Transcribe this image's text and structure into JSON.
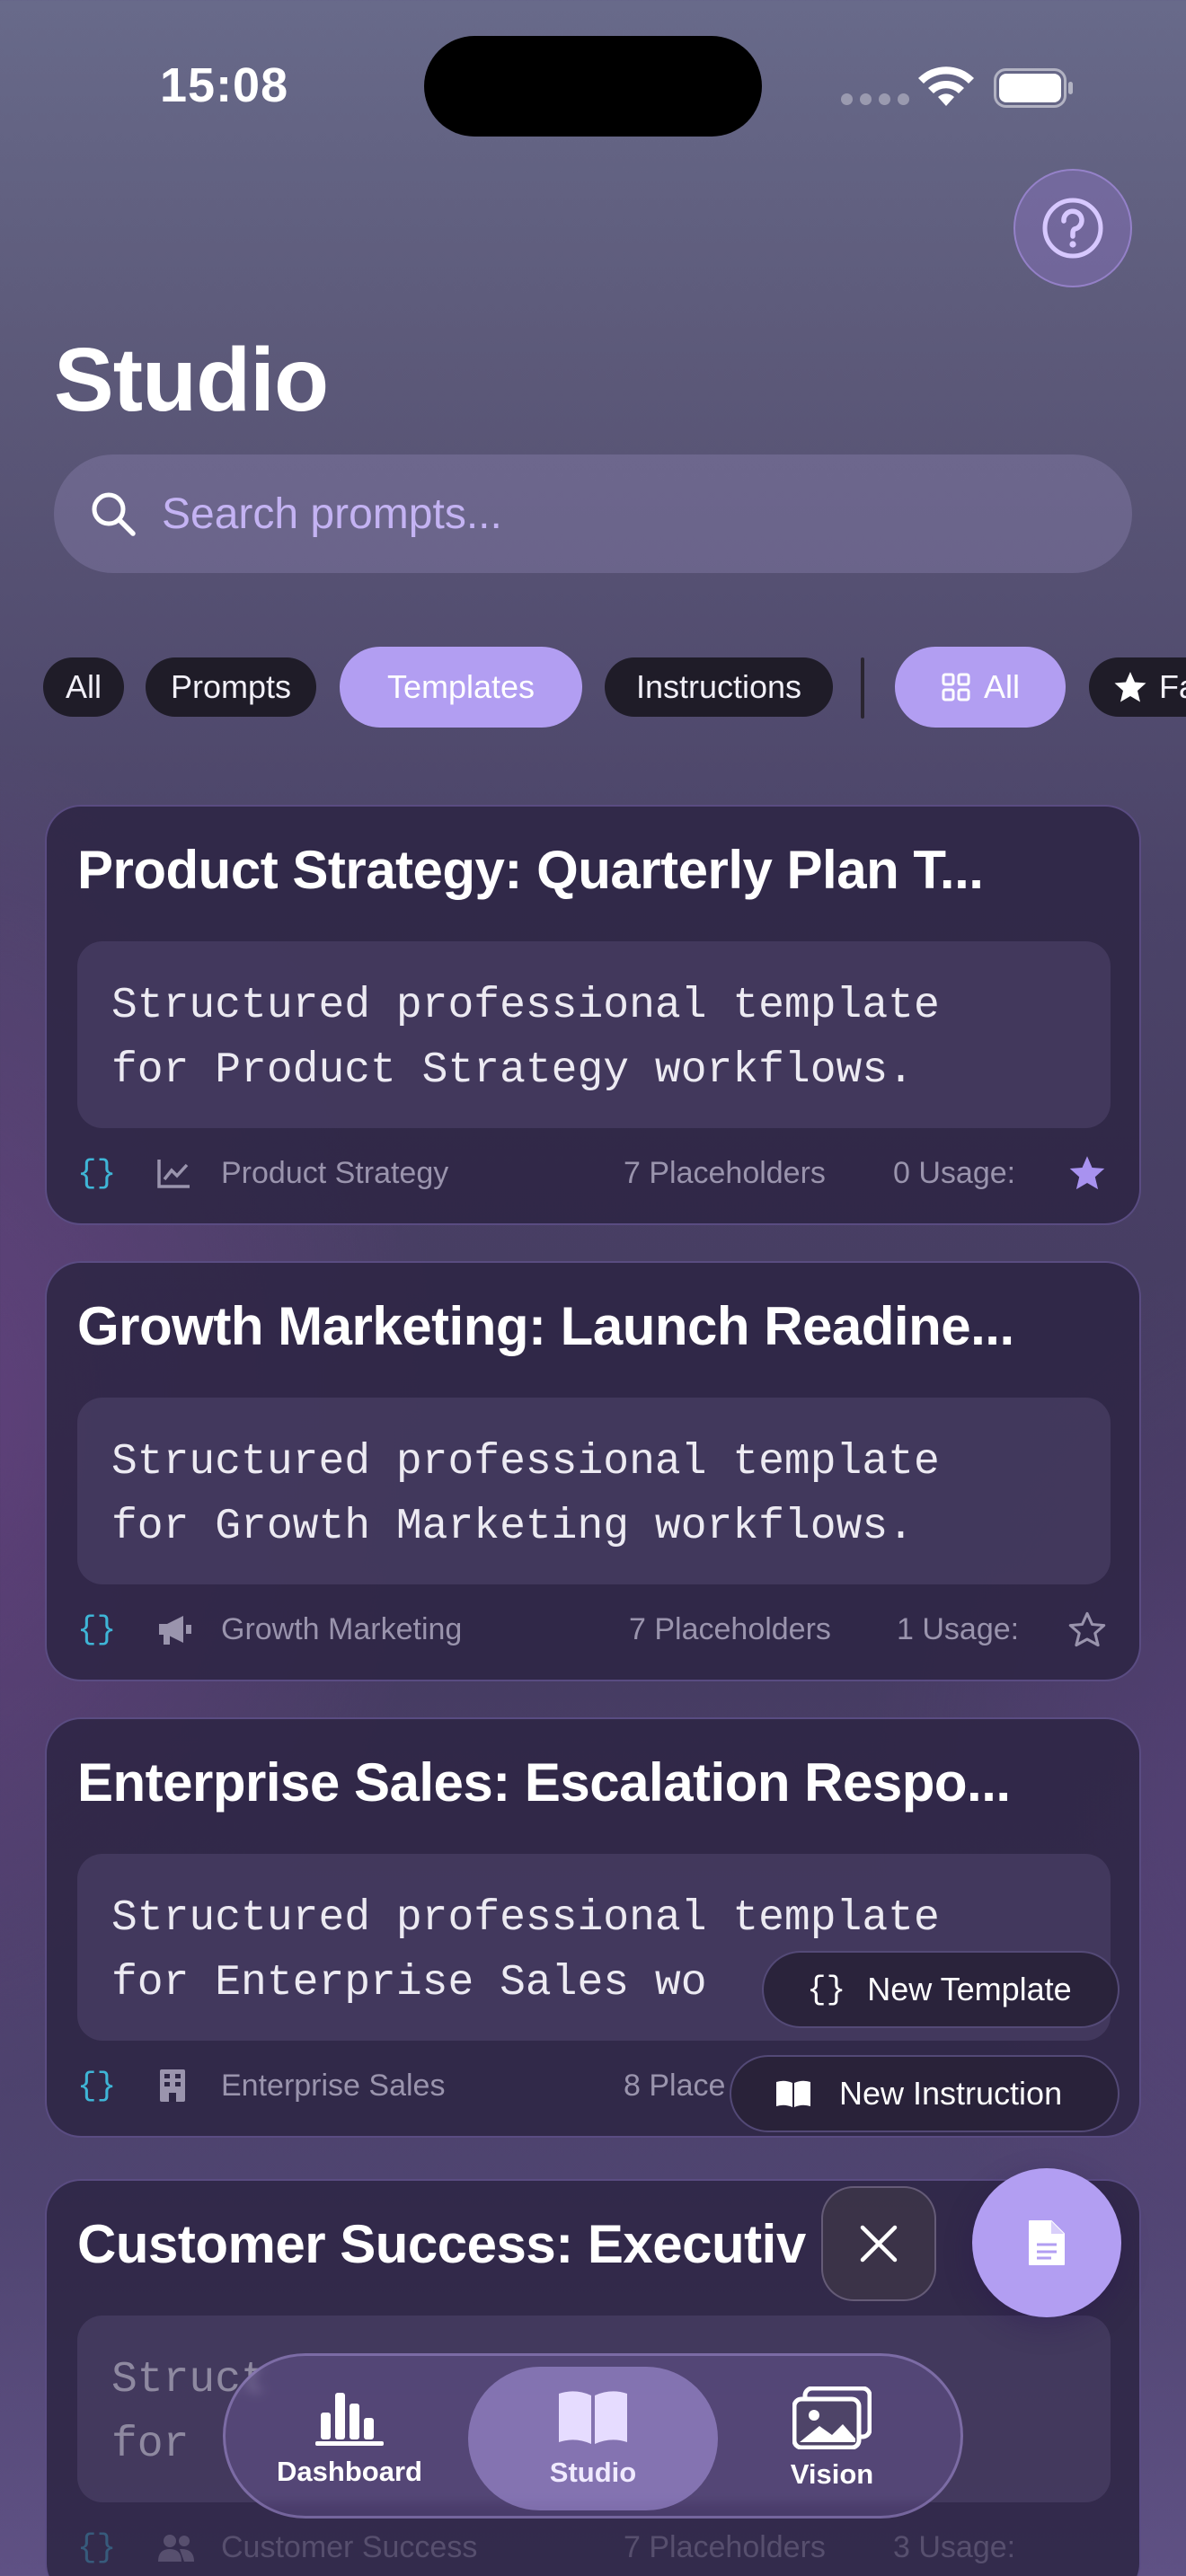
{
  "status_bar": {
    "time": "15:08"
  },
  "header": {
    "title": "Studio"
  },
  "search": {
    "placeholder": "Search prompts..."
  },
  "filters": {
    "type_chips": [
      "All",
      "Prompts",
      "Templates",
      "Instructions"
    ],
    "selected_type": "Templates",
    "view_chips": [
      "All",
      "Fa"
    ],
    "selected_view": "All"
  },
  "cards": [
    {
      "title": "Product Strategy: Quarterly Plan T...",
      "line1": "Structured professional template",
      "line2": "for Product Strategy workflows.",
      "type_icon": "{}",
      "category_icon": "chart-line-icon",
      "category": "Product Strategy",
      "placeholders": "7 Placeholders",
      "usage": "0 Usage:",
      "favorite": true
    },
    {
      "title": "Growth Marketing: Launch Readine...",
      "line1": "Structured professional template",
      "line2": "for Growth Marketing workflows.",
      "type_icon": "{}",
      "category_icon": "megaphone-icon",
      "category": "Growth Marketing",
      "placeholders": "7 Placeholders",
      "usage": "1 Usage:",
      "favorite": false
    },
    {
      "title": "Enterprise Sales: Escalation Respo...",
      "line1": "Structured professional template",
      "line2": "for Enterprise Sales wo",
      "type_icon": "{}",
      "category_icon": "building-icon",
      "category": "Enterprise Sales",
      "placeholders": "8 Place",
      "usage": "",
      "favorite": false
    },
    {
      "title": "Customer Success: Executiv",
      "line1": "Struct",
      "line2": "for",
      "type_icon": "{}",
      "category_icon": "people-icon",
      "category": "Customer Success",
      "placeholders": "7 Placeholders",
      "usage": "3 Usage:",
      "favorite": false
    }
  ],
  "fab_menu": {
    "new_template": "New Template",
    "new_template_icon": "{}",
    "new_instruction": "New Instruction"
  },
  "tabbar": {
    "tabs": [
      {
        "label": "Dashboard",
        "icon": "bar-chart-icon"
      },
      {
        "label": "Studio",
        "icon": "book-icon"
      },
      {
        "label": "Vision",
        "icon": "photos-icon"
      }
    ],
    "selected": "Studio"
  },
  "colors": {
    "accent": "#b29ef2",
    "placeholder_text": "#c4b3f3",
    "type_icon": "#3fb5d6",
    "meta_text": "#9a94ad"
  }
}
